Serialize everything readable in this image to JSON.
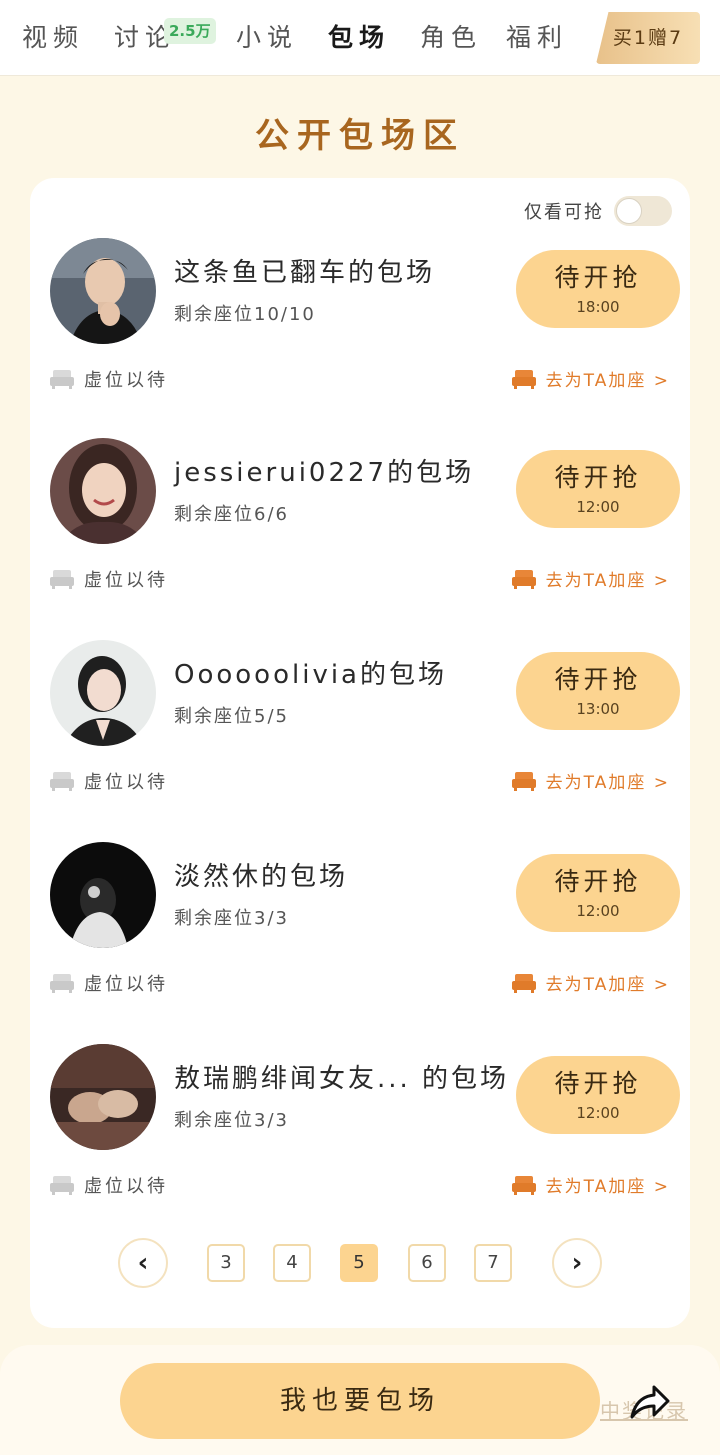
{
  "tabs": [
    {
      "label": "视频"
    },
    {
      "label": "讨论",
      "badge": "2.5万"
    },
    {
      "label": "小说"
    },
    {
      "label": "包场",
      "active": true
    },
    {
      "label": "角色"
    },
    {
      "label": "福利"
    }
  ],
  "promo": "买1赠7",
  "section_title": "公开包场区",
  "filter": {
    "label": "仅看可抢",
    "on": false
  },
  "entries": [
    {
      "name": "这条鱼已翻车的包场",
      "seats": "剩余座位10/10",
      "button": "待开抢",
      "time": "18:00",
      "vacant": "虚位以待",
      "add_seat": "去为TA加座 >"
    },
    {
      "name": "jessierui0227的包场",
      "seats": "剩余座位6/6",
      "button": "待开抢",
      "time": "12:00",
      "vacant": "虚位以待",
      "add_seat": "去为TA加座 >"
    },
    {
      "name": "Oooooolivia的包场",
      "seats": "剩余座位5/5",
      "button": "待开抢",
      "time": "13:00",
      "vacant": "虚位以待",
      "add_seat": "去为TA加座 >"
    },
    {
      "name": "淡然休的包场",
      "seats": "剩余座位3/3",
      "button": "待开抢",
      "time": "12:00",
      "vacant": "虚位以待",
      "add_seat": "去为TA加座 >"
    },
    {
      "name": "敖瑞鹏绯闻女友... 的包场",
      "seats": "剩余座位3/3",
      "button": "待开抢",
      "time": "12:00",
      "vacant": "虚位以待",
      "add_seat": "去为TA加座 >"
    }
  ],
  "pagination": {
    "prev": "‹",
    "next": "›",
    "pages": [
      "3",
      "4",
      "5",
      "6",
      "7"
    ],
    "current": "5"
  },
  "cta": "我也要包场",
  "records_link": "中奖记录",
  "colors": {
    "accent": "#fcd490",
    "title": "#a8661f",
    "link": "#e07b2a",
    "background": "#fdf7e6"
  }
}
